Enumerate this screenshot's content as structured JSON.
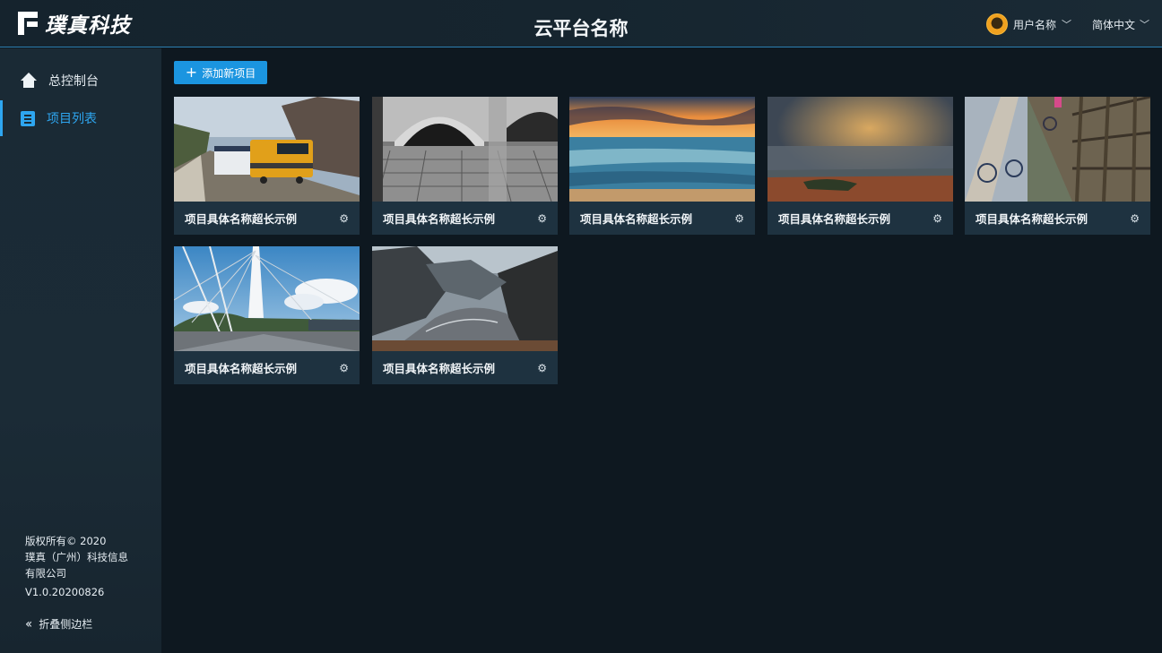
{
  "header": {
    "logo_text": "璞真科技",
    "app_title": "云平台名称",
    "user_name": "用户名称",
    "language": "简体中文"
  },
  "sidebar": {
    "items": [
      {
        "label": "总控制台",
        "icon": "home-icon",
        "active": false
      },
      {
        "label": "项目列表",
        "icon": "list-icon",
        "active": true
      }
    ],
    "copyright_line1": "版权所有© 2020",
    "copyright_line2": "璞真（广州）科技信息",
    "copyright_line3": "有限公司",
    "version": "V1.0.20200826",
    "collapse_label": "折叠侧边栏"
  },
  "main": {
    "add_button_label": "添加新项目",
    "cards": [
      {
        "title": "项目具体名称超长示例",
        "image": "train-photo"
      },
      {
        "title": "项目具体名称超长示例",
        "image": "bridge-arch-bw-photo"
      },
      {
        "title": "项目具体名称超长示例",
        "image": "sunset-sea-photo"
      },
      {
        "title": "项目具体名称超长示例",
        "image": "misty-landscape-photo"
      },
      {
        "title": "项目具体名称超长示例",
        "image": "trestle-bridge-photo"
      },
      {
        "title": "项目具体名称超长示例",
        "image": "cable-bridge-photo"
      },
      {
        "title": "项目具体名称超长示例",
        "image": "mountain-valley-photo"
      }
    ]
  },
  "colors": {
    "accent": "#1b95e0",
    "active_nav": "#2ea6f0",
    "background": "#0e1820",
    "sidebar": "#1a2a35",
    "card_bar": "#1e3240"
  }
}
